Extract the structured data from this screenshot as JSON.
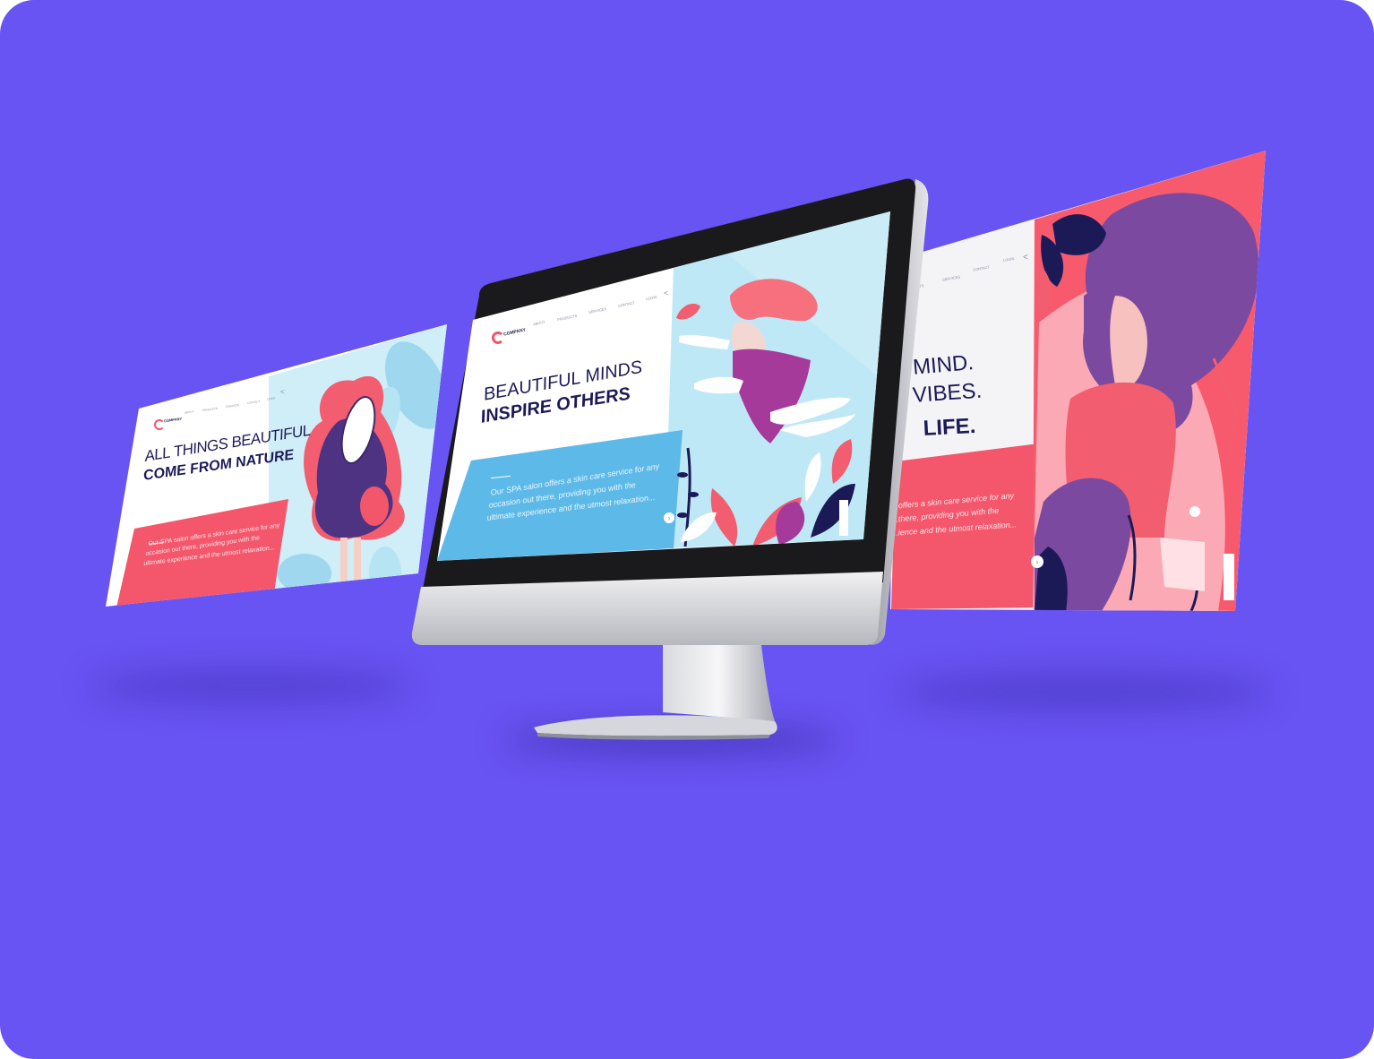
{
  "colors": {
    "background": "#6853f3",
    "coral": "#f2566b",
    "sky": "#bfe8f6",
    "navy": "#1b1a57",
    "purple": "#7b4aa0",
    "blue_panel": "#5db9e8"
  },
  "left_page": {
    "brand": "COMPANY",
    "nav": [
      "ABOUT",
      "PRODUCTS",
      "SERVICES",
      "CONTACT",
      "LOGIN"
    ],
    "headline_line1": "ALL THINGS BEAUTIFUL",
    "headline_line2": "COME FROM NATURE",
    "body_line1": "Our SPA salon offers a skin care service for any",
    "body_line2": "occasion out there, providing you with the",
    "body_line3": "ultimate experience and the utmost relaxation..."
  },
  "center_page": {
    "brand": "COMPANY",
    "nav": [
      "ABOUT",
      "PRODUCTS",
      "SERVICES",
      "CONTACT",
      "LOGIN"
    ],
    "headline_line1": "BEAUTIFUL MINDS",
    "headline_line2": "INSPIRE OTHERS",
    "body_line1": "Our SPA salon offers a skin care service for any",
    "body_line2": "occasion out there, providing you with the",
    "body_line3": "ultimate experience and the utmost relaxation..."
  },
  "right_page": {
    "nav": [
      "...CTS",
      "SERVICES",
      "CONTACT",
      "LOGIN"
    ],
    "headline_line1": "MIND.",
    "headline_line2": "VIBES.",
    "headline_line3": "LIFE.",
    "body_line1": "...offers a skin care service for any",
    "body_line2": "...there, providing you with the",
    "body_line3": "...ience and the utmost relaxation..."
  },
  "icons": {
    "share": "share-icon",
    "next": "chevron-right-icon",
    "scroll": "scroll-arrows-icon",
    "logo": "company-logo-icon"
  }
}
